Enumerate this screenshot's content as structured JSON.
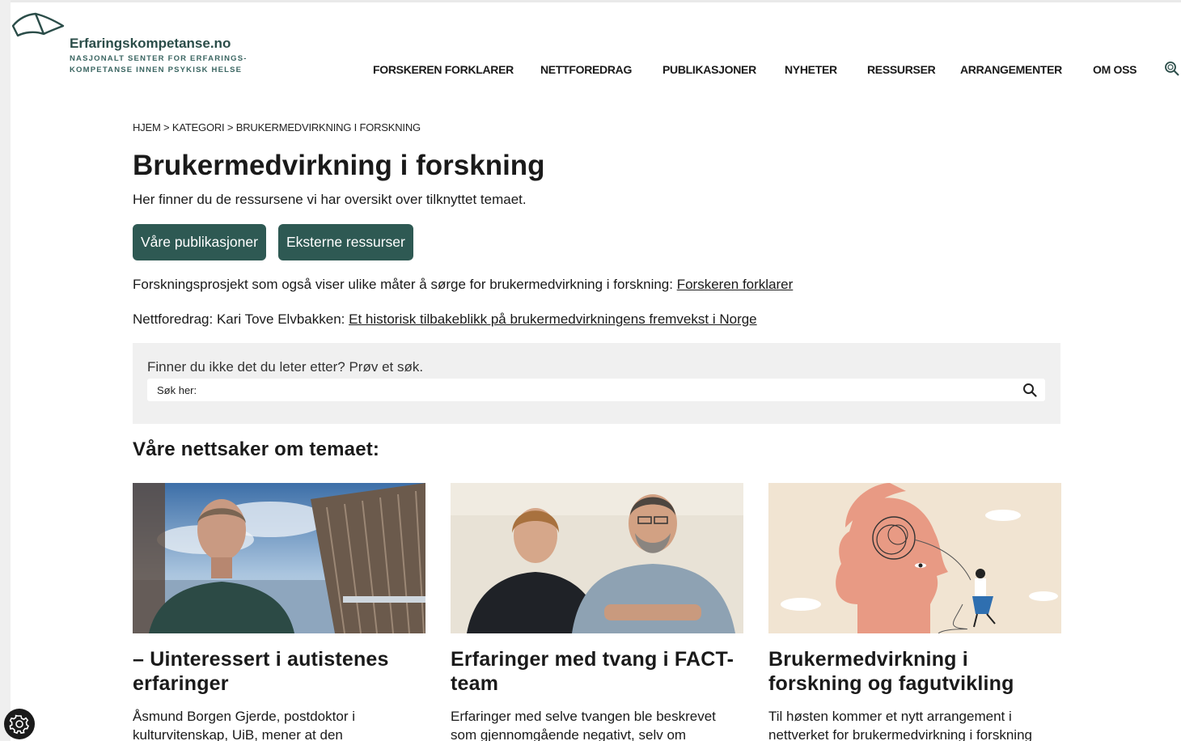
{
  "site": {
    "title": "Erfaringskompetanse.no",
    "subtitle_line1": "NASJONALT SENTER FOR ERFARINGS-",
    "subtitle_line2": "KOMPETANSE INNEN PSYKISK HELSE"
  },
  "nav": {
    "items": [
      "FORSKEREN FORKLARER",
      "NETTFOREDRAG",
      "PUBLIKASJONER",
      "NYHETER",
      "RESSURSER",
      "ARRANGEMENTER",
      "OM OSS"
    ],
    "search_icon": "magnifier-icon"
  },
  "breadcrumb": {
    "home": "HJEM",
    "category": "KATEGORI",
    "current": "BRUKERMEDVIRKNING I FORSKNING",
    "separator": ">"
  },
  "page": {
    "title": "Brukermedvirkning i forskning",
    "intro": "Her finner du de ressursene vi har oversikt over tilknyttet temaet."
  },
  "buttons": {
    "publications": "Våre publikasjoner",
    "external": "Eksterne ressurser"
  },
  "links": {
    "project_text": "Forskningsprosjekt som også viser ulike måter å sørge for brukermedvirkning i forskning: ",
    "project_link": "Forskeren forklarer",
    "lecture_text": "Nettforedrag: Kari Tove Elvbakken: ",
    "lecture_link": "Et historisk tilbakeblikk på brukermedvirkningens fremvekst i Norge"
  },
  "search": {
    "prompt": "Finner du ikke det du leter etter? Prøv et søk.",
    "placeholder": "Søk her:"
  },
  "articles": {
    "heading": "Våre nettsaker om temaet:",
    "items": [
      {
        "title": "– Uinteressert i autistenes erfaringer",
        "excerpt": "Åsmund Borgen Gjerde, postdoktor i kulturvitenskap, UiB, mener at den"
      },
      {
        "title": "Erfaringer med tvang i FACT-team",
        "excerpt": "Erfaringer med selve tvangen ble beskrevet som gjennomgående negativt, selv om"
      },
      {
        "title": "Brukermedvirkning i forskning og fagutvikling",
        "excerpt": "Til høsten kommer et nytt arrangement i nettverket for brukermedvirkning i forskning"
      }
    ]
  },
  "colors": {
    "brand": "#2e5953",
    "search_bg": "#f0f0f0"
  }
}
